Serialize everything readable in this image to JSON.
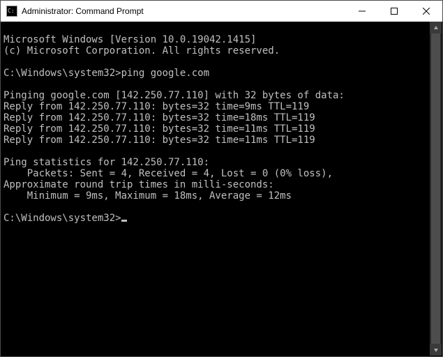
{
  "window": {
    "title": "Administrator: Command Prompt"
  },
  "terminal": {
    "banner1": "Microsoft Windows [Version 10.0.19042.1415]",
    "banner2": "(c) Microsoft Corporation. All rights reserved.",
    "blank1": "",
    "prompt1": "C:\\Windows\\system32>",
    "command1": "ping google.com",
    "blank2": "",
    "ping_header": "Pinging google.com [142.250.77.110] with 32 bytes of data:",
    "reply1": "Reply from 142.250.77.110: bytes=32 time=9ms TTL=119",
    "reply2": "Reply from 142.250.77.110: bytes=32 time=18ms TTL=119",
    "reply3": "Reply from 142.250.77.110: bytes=32 time=11ms TTL=119",
    "reply4": "Reply from 142.250.77.110: bytes=32 time=11ms TTL=119",
    "blank3": "",
    "stats1": "Ping statistics for 142.250.77.110:",
    "stats2": "    Packets: Sent = 4, Received = 4, Lost = 0 (0% loss),",
    "stats3": "Approximate round trip times in milli-seconds:",
    "stats4": "    Minimum = 9ms, Maximum = 18ms, Average = 12ms",
    "blank4": "",
    "prompt2": "C:\\Windows\\system32>"
  }
}
